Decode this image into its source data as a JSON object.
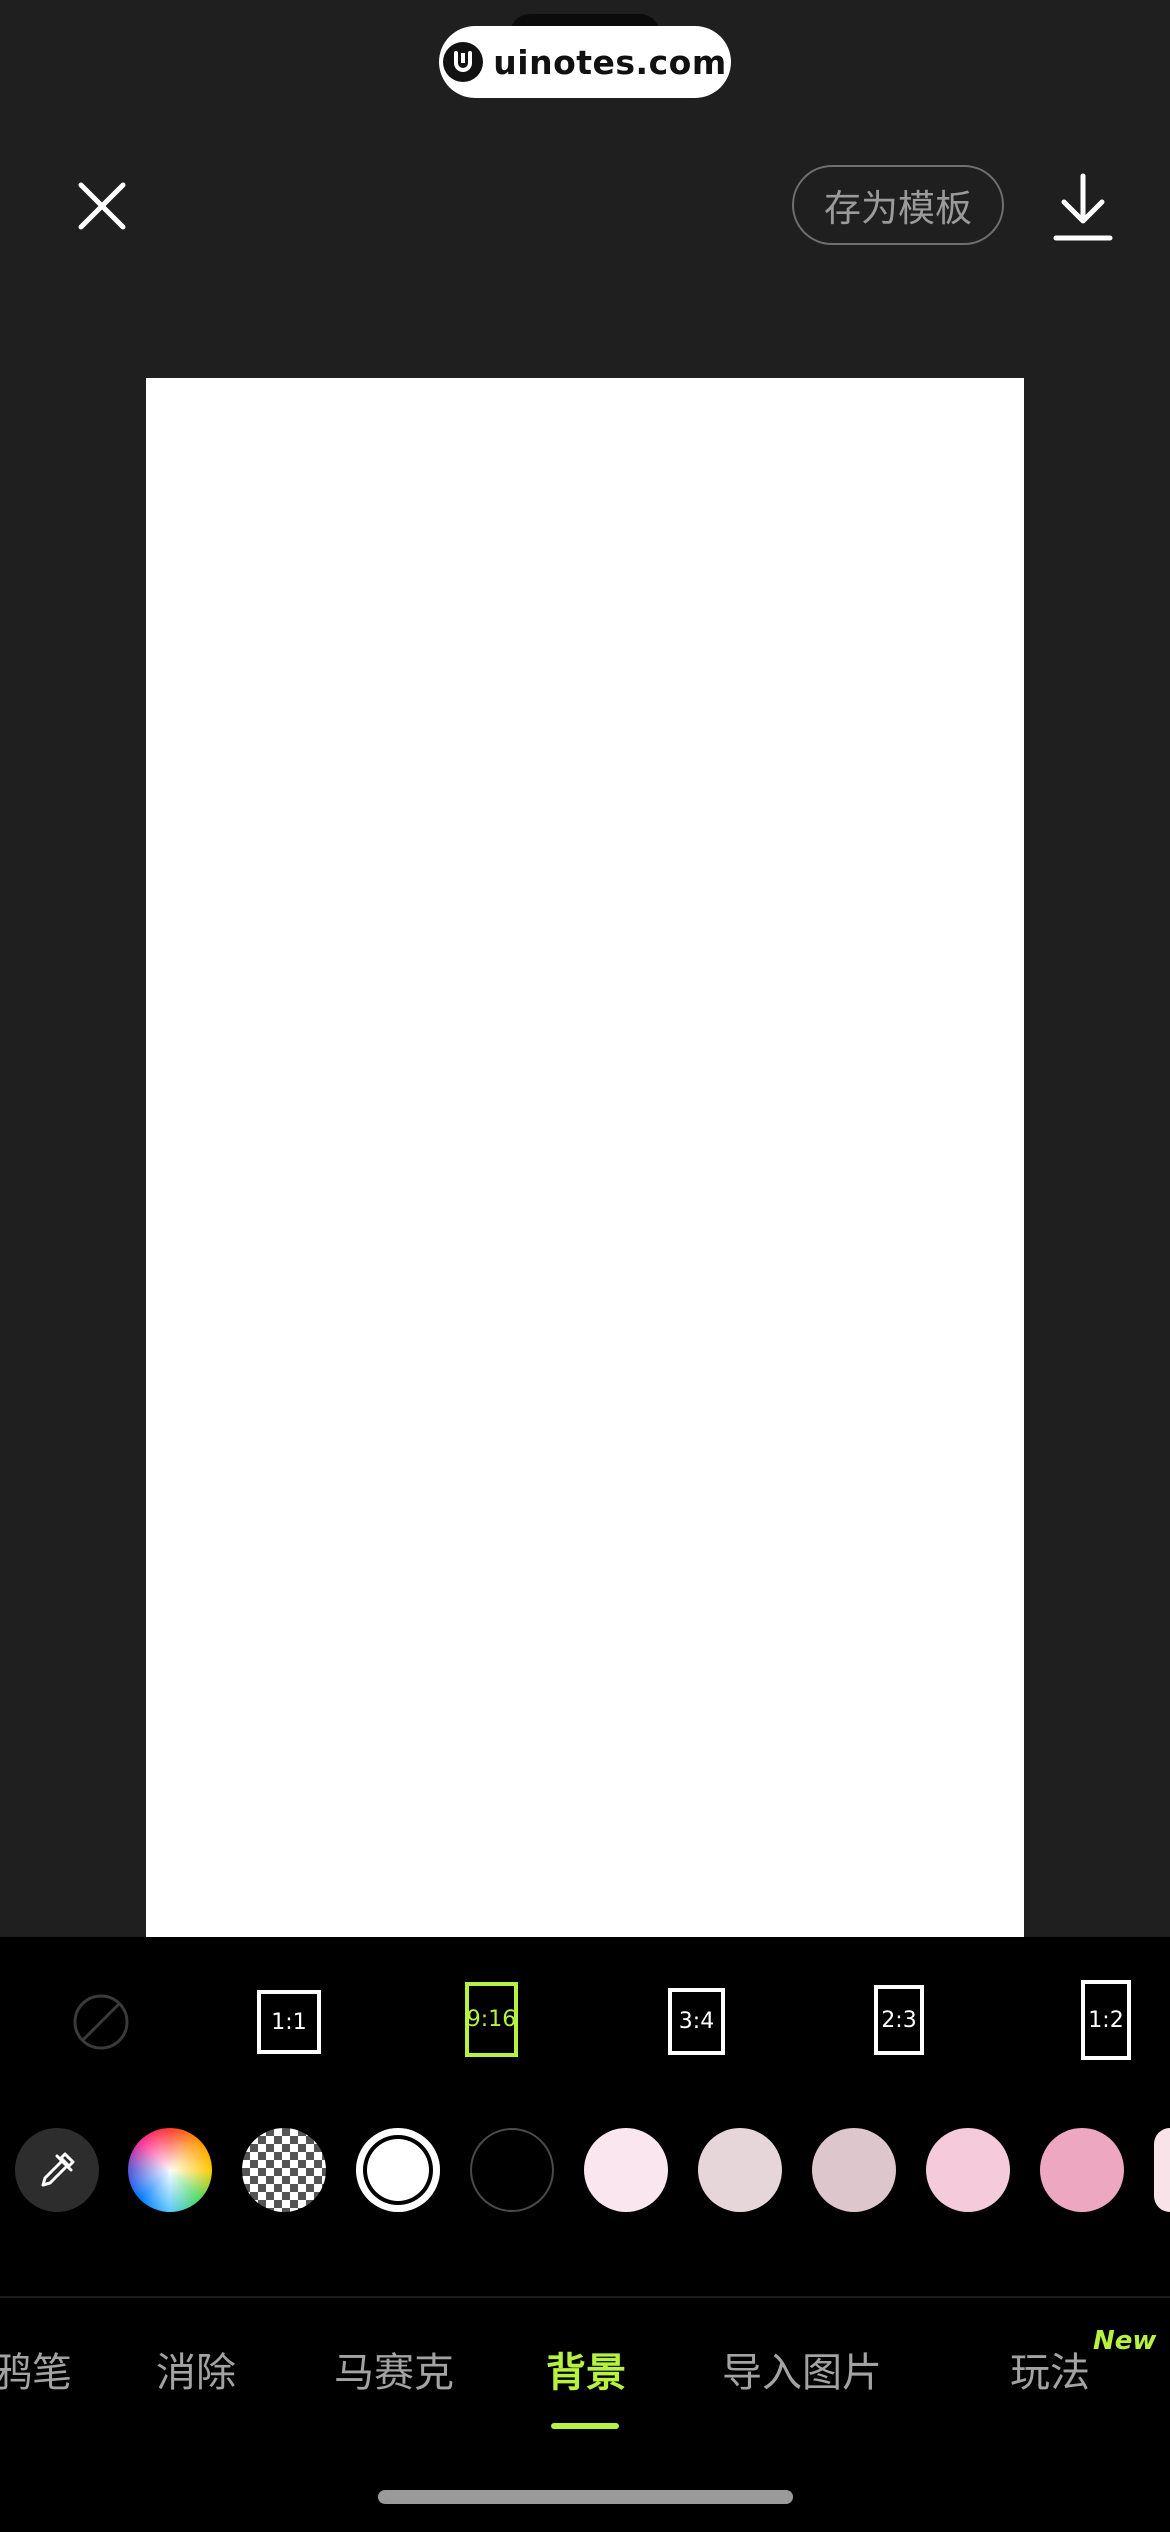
{
  "watermark": {
    "text": "uinotes.com"
  },
  "header": {
    "save_template_label": "存为模板"
  },
  "ratios": [
    {
      "label": "1:1"
    },
    {
      "label": "9:16",
      "selected": true
    },
    {
      "label": "3:4"
    },
    {
      "label": "2:3"
    },
    {
      "label": "1:2"
    }
  ],
  "colors": {
    "accent": "#b6f23f",
    "canvas_background": "#ffffff",
    "swatches": [
      "#ffffff",
      "#000000",
      "#f9e6ee",
      "#e6d5d9",
      "#ddc6cc",
      "#f5cadb",
      "#eea7c0",
      "#f7e3e8"
    ]
  },
  "tabs": [
    {
      "label": "鸦笔"
    },
    {
      "label": "消除"
    },
    {
      "label": "马赛克"
    },
    {
      "label": "背景",
      "active": true
    },
    {
      "label": "导入图片"
    },
    {
      "label": "玩法",
      "badge": "New"
    }
  ],
  "icons": [
    "close-icon",
    "download-icon",
    "none-icon",
    "eyedropper-icon",
    "color-wheel-icon",
    "transparent-checker-icon"
  ]
}
